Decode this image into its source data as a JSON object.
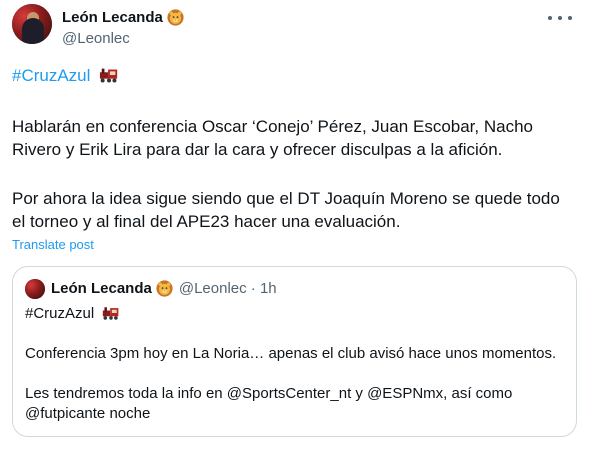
{
  "tweet": {
    "display_name": "León Lecanda",
    "handle": "@Leonlec",
    "hashtag": "#CruzAzul",
    "paragraph1_line1": "Hablarán en conferencia Oscar ‘Conejo’ Pérez, Juan Escobar, Nacho",
    "paragraph1_line2": "Rivero y Erik Lira para dar la cara y ofrecer disculpas a la afición.",
    "paragraph2_line1": "Por ahora la idea sigue siendo que el DT Joaquín Moreno se quede todo",
    "paragraph2_line2": "el torneo y al final del APE23 hacer una evaluación.",
    "translate_label": "Translate post"
  },
  "quoted": {
    "display_name": "León Lecanda",
    "handle_time": "@Leonlec · 1h",
    "hashtag": "#CruzAzul",
    "line1": "Conferencia 3pm hoy en La Noria… apenas el club avisó hace unos momentos.",
    "line2": "Les tendremos toda la info en @SportsCenter_nt y @ESPNmx, así como",
    "line3": "@futpicante noche"
  },
  "icons": {
    "verified_emoji": "lion-face-icon",
    "hashtag_emoji": "train-icon",
    "menu": "more-options-icon"
  },
  "colors": {
    "link": "#1d9bf0",
    "secondary_text": "#536471",
    "border": "#cfd9de"
  }
}
